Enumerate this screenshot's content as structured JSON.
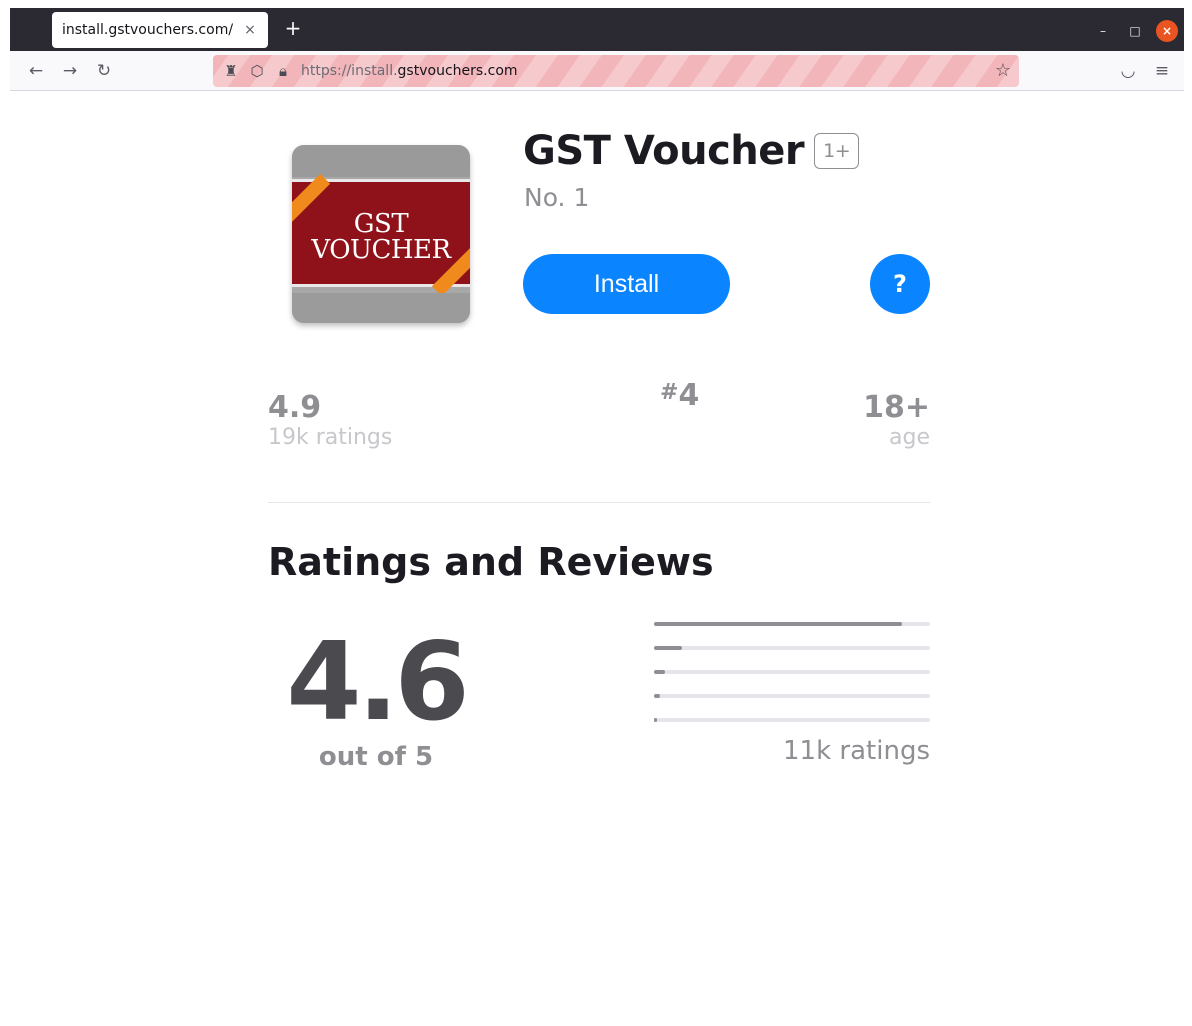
{
  "browser": {
    "tab_title": "install.gstvouchers.com/",
    "tab_close": "×",
    "new_tab": "+",
    "url_scheme": "https://install.",
    "url_host": "gstvouchers.com"
  },
  "app": {
    "icon_text_line1": "GST",
    "icon_text_line2": "VOUCHER",
    "title": "GST Voucher",
    "age_badge": "1+",
    "subtitle": "No. 1",
    "install_label": "Install",
    "help_label": "?"
  },
  "stats": {
    "rating_value": "4.9",
    "rating_label": "19k ratings",
    "rank_hash": "#",
    "rank_value": "4",
    "age_value": "18+",
    "age_label": "age"
  },
  "reviews": {
    "section_title": "Ratings and Reviews",
    "score": "4.6",
    "out_of": "out of 5",
    "ratings_count": "11k ratings",
    "distribution": [
      0.9,
      0.1,
      0.04,
      0.02,
      0.01
    ]
  },
  "colors": {
    "accent": "#0a84ff",
    "muted": "#8e8e93"
  }
}
